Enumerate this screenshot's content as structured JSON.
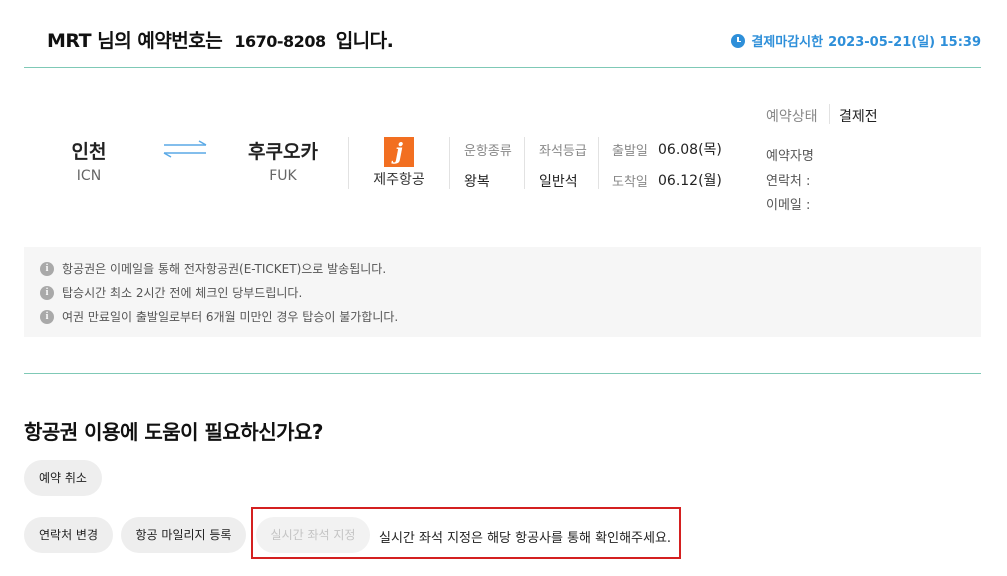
{
  "header": {
    "title_prefix": "MRT 님의 예약번호는",
    "booking_number": "1670-8208",
    "title_suffix": "입니다.",
    "deadline_label": "결제마감시한",
    "deadline_value": "2023-05-21(일) 15:39"
  },
  "flight": {
    "origin_city": "인천",
    "origin_code": "ICN",
    "dest_city": "후쿠오카",
    "dest_code": "FUK",
    "airline_logo_letter": "j",
    "airline_name": "제주항공",
    "trip_type_label": "운항종류",
    "trip_type_value": "왕복",
    "seat_class_label": "좌석등급",
    "seat_class_value": "일반석",
    "depart_label": "출발일",
    "depart_value": "06.08(목)",
    "arrive_label": "도착일",
    "arrive_value": "06.12(월)"
  },
  "booking_info": {
    "status_label": "예약상태",
    "status_value": "결제전",
    "name_label": "예약자명",
    "phone_label": "연락처 :",
    "email_label": "이메일 :"
  },
  "notices": [
    "항공권은 이메일을 통해 전자항공권(E-TICKET)으로 발송됩니다.",
    "탑승시간 최소 2시간 전에 체크인 당부드립니다.",
    "여권 만료일이 출발일로부터 6개월 미만인 경우 탑승이 불가합니다."
  ],
  "help": {
    "title": "항공권 이용에 도움이 필요하신가요?",
    "cancel_button": "예약 취소",
    "contact_button": "연락처 변경",
    "mileage_button": "항공 마일리지 등록",
    "seat_button": "실시간 좌석 지정",
    "seat_message": "실시간 좌석 지정은 해당 항공사를 통해 확인해주세요."
  },
  "colors": {
    "accent_blue": "#2e8fd9",
    "divider_green": "#7fc9b6",
    "airline_orange": "#f26f21",
    "highlight_red": "#d42020"
  }
}
